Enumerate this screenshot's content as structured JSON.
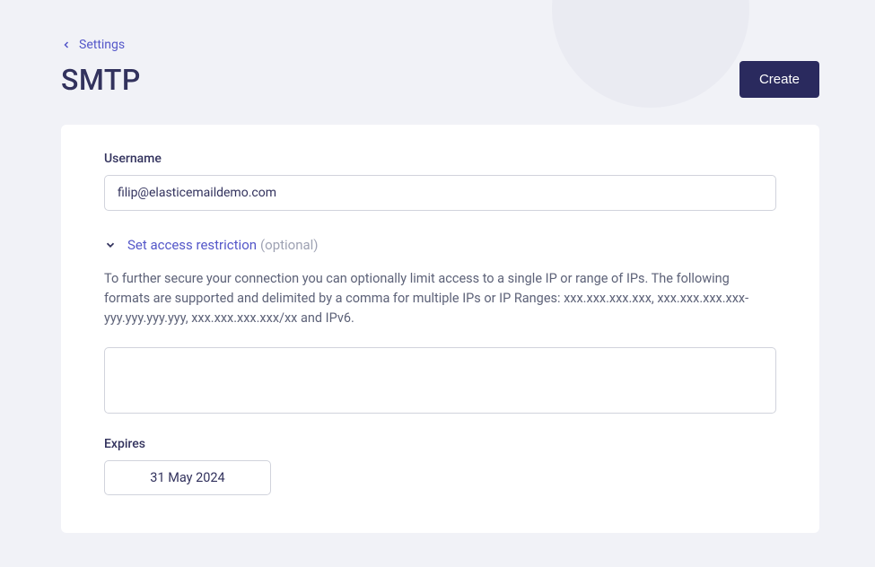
{
  "breadcrumb": {
    "link_label": "Settings"
  },
  "header": {
    "title": "SMTP",
    "create_label": "Create"
  },
  "form": {
    "username_label": "Username",
    "username_value": "filip@elasticemaildemo.com",
    "access_restriction": {
      "label": "Set access restriction",
      "optional_text": "(optional)",
      "description": "To further secure your connection you can optionally limit access to a single IP or range of IPs. The following formats are supported and delimited by a comma for multiple IPs or IP Ranges: xxx.xxx.xxx.xxx, xxx.xxx.xxx.xxx-yyy.yyy.yyy.yyy, xxx.xxx.xxx.xxx/xx and IPv6.",
      "value": ""
    },
    "expires": {
      "label": "Expires",
      "value": "31 May 2024"
    }
  }
}
